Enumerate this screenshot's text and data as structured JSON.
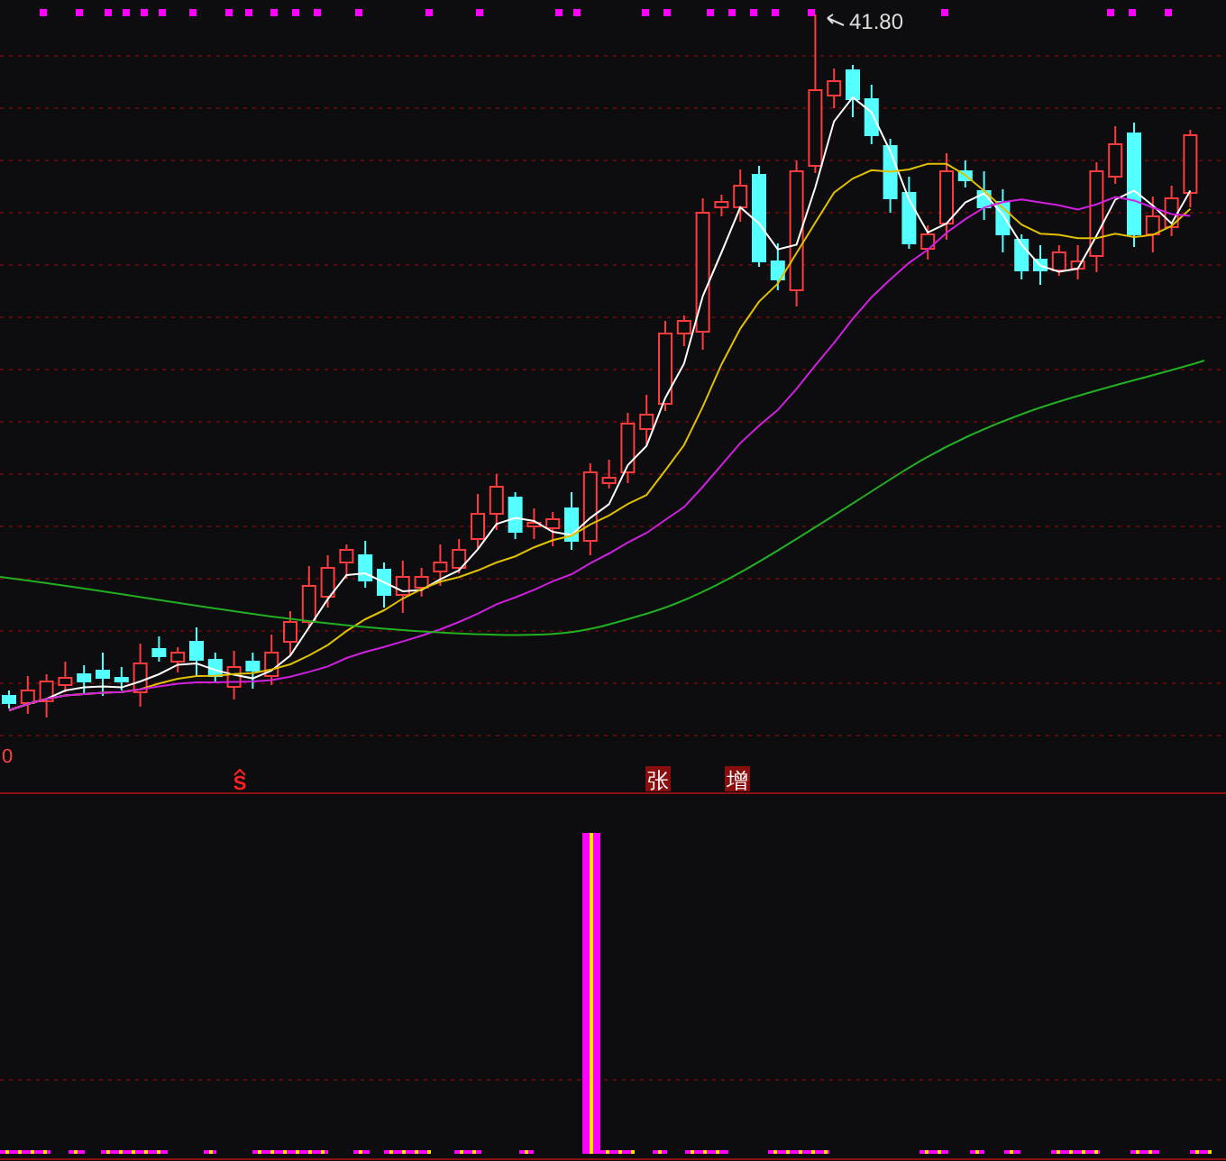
{
  "price_chart": {
    "high_label": "41.80",
    "axis_label": "0"
  },
  "signals": [
    {
      "text": "S",
      "kind": "arrow"
    },
    {
      "text": "张",
      "kind": "box"
    },
    {
      "text": "增",
      "kind": "box"
    }
  ]
}
